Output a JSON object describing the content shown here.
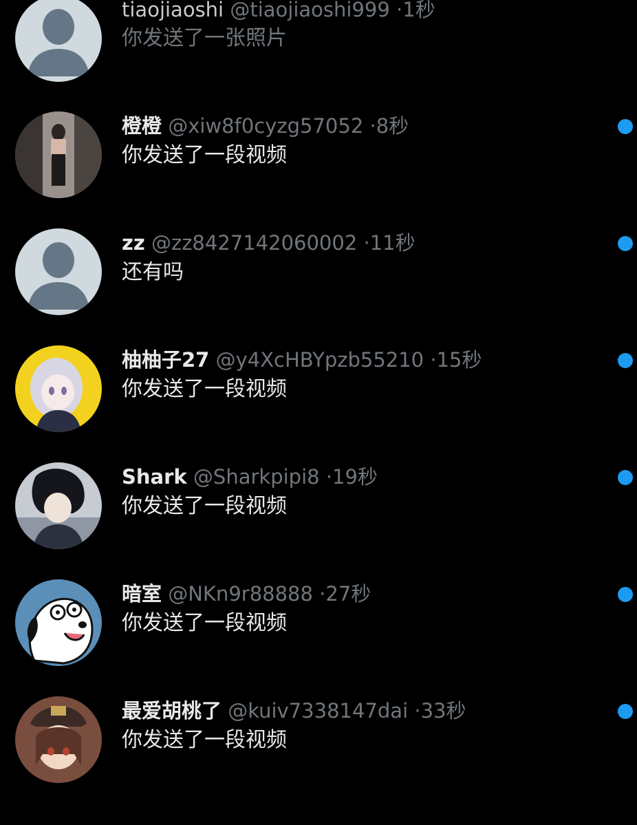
{
  "conversations": [
    {
      "name": "tiaojiaoshi",
      "handle": "@tiaojiaoshi999",
      "separator": "·",
      "time": "1秒",
      "preview": "你发送了一张照片",
      "avatar_icon": "default-profile-icon",
      "unread": false
    },
    {
      "name": "橙橙",
      "handle": "@xiw8f0cyzg57052",
      "separator": "·",
      "time": "8秒",
      "preview": "你发送了一段视频",
      "avatar_icon": "photo-avatar",
      "unread": true
    },
    {
      "name": "zz",
      "handle": "@zz8427142060002",
      "separator": "·",
      "time": "11秒",
      "preview": "还有吗",
      "avatar_icon": "default-profile-icon",
      "unread": true
    },
    {
      "name": "柚柚子27",
      "handle": "@y4XcHBYpzb55210",
      "separator": "·",
      "time": "15秒",
      "preview": "你发送了一段视频",
      "avatar_icon": "anime-avatar",
      "unread": true
    },
    {
      "name": "Shark",
      "handle": "@Sharkpipi8",
      "separator": "·",
      "time": "19秒",
      "preview": "你发送了一段视频",
      "avatar_icon": "anime-avatar",
      "unread": true
    },
    {
      "name": "暗室",
      "handle": "@NKn9r88888",
      "separator": "·",
      "time": "27秒",
      "preview": "你发送了一段视频",
      "avatar_icon": "cartoon-dog-avatar",
      "unread": true
    },
    {
      "name": "最爱胡桃了",
      "handle": "@kuiv7338147dai",
      "separator": "·",
      "time": "33秒",
      "preview": "你发送了一段视频",
      "avatar_icon": "anime-avatar",
      "unread": true
    }
  ],
  "colors": {
    "background": "#000000",
    "primary_text": "#e7e9ea",
    "secondary_text": "#71767b",
    "unread_dot": "#1d9bf0"
  }
}
